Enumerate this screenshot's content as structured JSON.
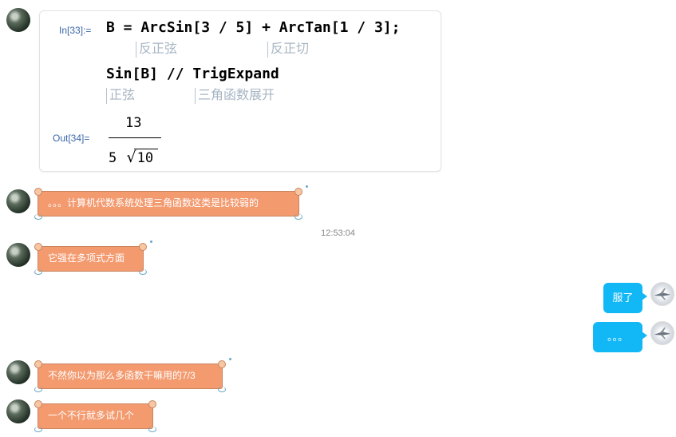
{
  "card": {
    "in_label": "In[33]:=",
    "line1": "B = ArcSin[3 / 5] + ArcTan[1 / 3];",
    "line1_hint_a": "反正弦",
    "line1_hint_b": "反正切",
    "line2": "Sin[B] // TrigExpand",
    "line2_hint_a": "正弦",
    "line2_hint_b": "三角函数展开",
    "out_label": "Out[34]=",
    "numerator": "13",
    "den_coeff": "5",
    "den_radical": "10"
  },
  "messages": [
    {
      "side": "left",
      "style": "scroll",
      "text": "。。。计算机代数系统处理三角函数这类是比较弱的"
    },
    {
      "side": "left",
      "style": "scroll",
      "text": "它强在多项式方面"
    },
    {
      "side": "right",
      "style": "blue",
      "text": "服了"
    },
    {
      "side": "right",
      "style": "blue",
      "text": "。。。"
    },
    {
      "side": "left",
      "style": "scroll",
      "text": "不然你以为那么多函数干嘛用的7/3"
    },
    {
      "side": "left",
      "style": "scroll",
      "text": "一个不行就多试几个"
    }
  ],
  "timestamp": "12:53:04",
  "colors": {
    "scroll_bg": "#f39a6f",
    "blue_bubble": "#12b7f5",
    "label_blue": "#3a67a8",
    "hint_gray": "#a8b6c4"
  },
  "icons": {
    "left_avatar": "pine-tree-avatar",
    "right_avatar": "fighter-jet-avatar"
  }
}
